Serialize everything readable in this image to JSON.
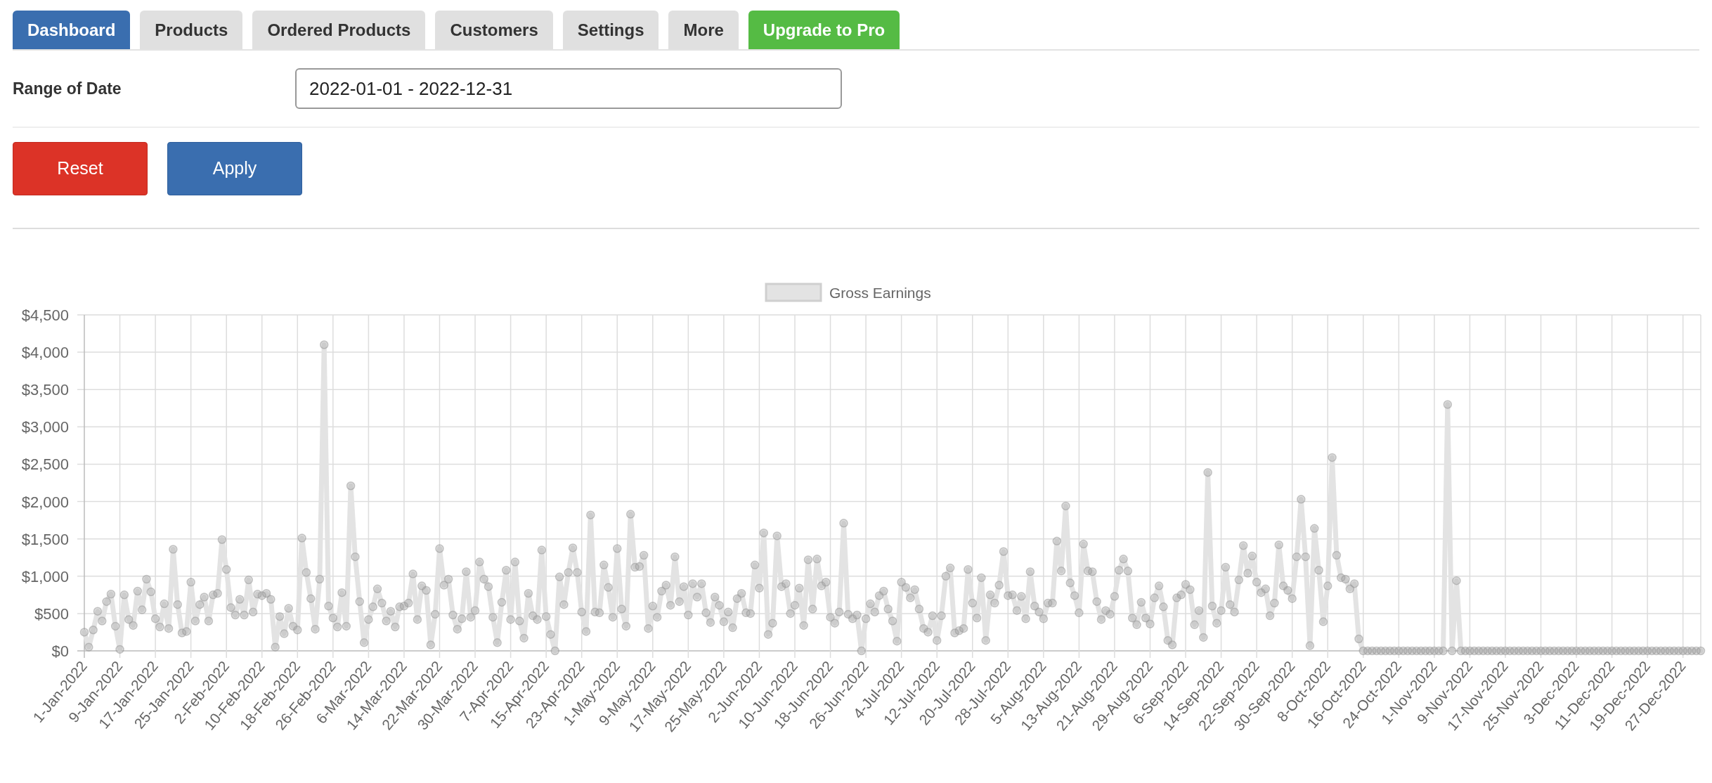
{
  "tabs": [
    {
      "label": "Dashboard",
      "selected": true,
      "kind": "normal"
    },
    {
      "label": "Products",
      "selected": false,
      "kind": "normal"
    },
    {
      "label": "Ordered Products",
      "selected": false,
      "kind": "normal"
    },
    {
      "label": "Customers",
      "selected": false,
      "kind": "normal"
    },
    {
      "label": "Settings",
      "selected": false,
      "kind": "normal"
    },
    {
      "label": "More",
      "selected": false,
      "kind": "normal"
    },
    {
      "label": "Upgrade to Pro",
      "selected": false,
      "kind": "upgrade"
    }
  ],
  "date_range": {
    "label": "Range of Date",
    "value": "2022-01-01 - 2022-12-31"
  },
  "buttons": [
    {
      "label": "Reset",
      "kind": "danger"
    },
    {
      "label": "Apply",
      "kind": "primary"
    }
  ],
  "chart": {
    "chart_data": {
      "type": "line",
      "grid": true,
      "ylim": [
        0,
        4500
      ],
      "categories": [
        "1-Jan-2022",
        null,
        null,
        null,
        null,
        null,
        null,
        null,
        "9-Jan-2022",
        null,
        null,
        null,
        null,
        null,
        null,
        null,
        "17-Jan-2022",
        null,
        null,
        null,
        null,
        null,
        null,
        null,
        "25-Jan-2022",
        null,
        null,
        null,
        null,
        null,
        null,
        null,
        "2-Feb-2022",
        null,
        null,
        null,
        null,
        null,
        null,
        null,
        "10-Feb-2022",
        null,
        null,
        null,
        null,
        null,
        null,
        null,
        "18-Feb-2022",
        null,
        null,
        null,
        null,
        null,
        null,
        null,
        "26-Feb-2022",
        null,
        null,
        null,
        null,
        null,
        null,
        null,
        "6-Mar-2022",
        null,
        null,
        null,
        null,
        null,
        null,
        null,
        "14-Mar-2022",
        null,
        null,
        null,
        null,
        null,
        null,
        null,
        "22-Mar-2022",
        null,
        null,
        null,
        null,
        null,
        null,
        null,
        "30-Mar-2022",
        null,
        null,
        null,
        null,
        null,
        null,
        null,
        "7-Apr-2022",
        null,
        null,
        null,
        null,
        null,
        null,
        null,
        "15-Apr-2022",
        null,
        null,
        null,
        null,
        null,
        null,
        null,
        "23-Apr-2022",
        null,
        null,
        null,
        null,
        null,
        null,
        null,
        "1-May-2022",
        null,
        null,
        null,
        null,
        null,
        null,
        null,
        "9-May-2022",
        null,
        null,
        null,
        null,
        null,
        null,
        null,
        "17-May-2022",
        null,
        null,
        null,
        null,
        null,
        null,
        null,
        "25-May-2022",
        null,
        null,
        null,
        null,
        null,
        null,
        null,
        "2-Jun-2022",
        null,
        null,
        null,
        null,
        null,
        null,
        null,
        "10-Jun-2022",
        null,
        null,
        null,
        null,
        null,
        null,
        null,
        "18-Jun-2022",
        null,
        null,
        null,
        null,
        null,
        null,
        null,
        "26-Jun-2022",
        null,
        null,
        null,
        null,
        null,
        null,
        null,
        "4-Jul-2022",
        null,
        null,
        null,
        null,
        null,
        null,
        null,
        "12-Jul-2022",
        null,
        null,
        null,
        null,
        null,
        null,
        null,
        "20-Jul-2022",
        null,
        null,
        null,
        null,
        null,
        null,
        null,
        "28-Jul-2022",
        null,
        null,
        null,
        null,
        null,
        null,
        null,
        "5-Aug-2022",
        null,
        null,
        null,
        null,
        null,
        null,
        null,
        "13-Aug-2022",
        null,
        null,
        null,
        null,
        null,
        null,
        null,
        "21-Aug-2022",
        null,
        null,
        null,
        null,
        null,
        null,
        null,
        "29-Aug-2022",
        null,
        null,
        null,
        null,
        null,
        null,
        null,
        "6-Sep-2022",
        null,
        null,
        null,
        null,
        null,
        null,
        null,
        "14-Sep-2022",
        null,
        null,
        null,
        null,
        null,
        null,
        null,
        "22-Sep-2022",
        null,
        null,
        null,
        null,
        null,
        null,
        null,
        "30-Sep-2022",
        null,
        null,
        null,
        null,
        null,
        null,
        null,
        "8-Oct-2022",
        null,
        null,
        null,
        null,
        null,
        null,
        null,
        "16-Oct-2022",
        null,
        null,
        null,
        null,
        null,
        null,
        null,
        "24-Oct-2022",
        null,
        null,
        null,
        null,
        null,
        null,
        null,
        "1-Nov-2022",
        null,
        null,
        null,
        null,
        null,
        null,
        null,
        "9-Nov-2022",
        null,
        null,
        null,
        null,
        null,
        null,
        null,
        "17-Nov-2022",
        null,
        null,
        null,
        null,
        null,
        null,
        null,
        "25-Nov-2022",
        null,
        null,
        null,
        null,
        null,
        null,
        null,
        "3-Dec-2022",
        null,
        null,
        null,
        null,
        null,
        null,
        null,
        "11-Dec-2022",
        null,
        null,
        null,
        null,
        null,
        null,
        null,
        "19-Dec-2022",
        null,
        null,
        null,
        null,
        null,
        null,
        null,
        "27-Dec-2022",
        null,
        null,
        null,
        null
      ],
      "yticks": [
        {
          "value": 0,
          "label": "$0"
        },
        {
          "value": 500,
          "label": "$500"
        },
        {
          "value": 1000,
          "label": "$1,000"
        },
        {
          "value": 1500,
          "label": "$1,500"
        },
        {
          "value": 2000,
          "label": "$2,000"
        },
        {
          "value": 2500,
          "label": "$2,500"
        },
        {
          "value": 3000,
          "label": "$3,000"
        },
        {
          "value": 3500,
          "label": "$3,500"
        },
        {
          "value": 4000,
          "label": "$4,000"
        },
        {
          "value": 4500,
          "label": "$4,500"
        }
      ],
      "series": [
        {
          "name": "Gross Earnings",
          "color": "#e3e3e3",
          "marker": "circle",
          "values": [
            250,
            50,
            280,
            530,
            400,
            660,
            760,
            330,
            20,
            750,
            420,
            340,
            800,
            550,
            960,
            790,
            430,
            320,
            630,
            300,
            1360,
            620,
            240,
            260,
            920,
            400,
            620,
            720,
            400,
            750,
            770,
            1490,
            1090,
            580,
            480,
            690,
            480,
            950,
            520,
            760,
            740,
            770,
            690,
            50,
            460,
            230,
            570,
            330,
            280,
            1510,
            1050,
            700,
            290,
            960,
            4100,
            600,
            440,
            320,
            780,
            330,
            2210,
            1260,
            660,
            110,
            420,
            590,
            830,
            640,
            400,
            530,
            320,
            590,
            600,
            640,
            1030,
            420,
            870,
            810,
            80,
            490,
            1370,
            880,
            960,
            480,
            290,
            430,
            1060,
            450,
            540,
            1190,
            960,
            860,
            450,
            110,
            650,
            1080,
            420,
            1190,
            400,
            170,
            770,
            470,
            420,
            1350,
            460,
            220,
            0,
            990,
            620,
            1050,
            1380,
            1050,
            520,
            260,
            1820,
            520,
            510,
            1150,
            850,
            450,
            1370,
            560,
            330,
            1830,
            1120,
            1130,
            1280,
            300,
            600,
            450,
            800,
            880,
            610,
            1260,
            660,
            860,
            480,
            900,
            720,
            900,
            510,
            380,
            720,
            610,
            390,
            520,
            310,
            700,
            770,
            510,
            500,
            1150,
            840,
            1580,
            220,
            370,
            1540,
            860,
            900,
            500,
            610,
            840,
            340,
            1220,
            560,
            1230,
            870,
            920,
            450,
            370,
            520,
            1710,
            490,
            430,
            480,
            0,
            430,
            630,
            520,
            740,
            800,
            560,
            400,
            130,
            920,
            850,
            710,
            820,
            560,
            300,
            250,
            470,
            140,
            470,
            1000,
            1110,
            240,
            270,
            300,
            1090,
            640,
            440,
            980,
            140,
            750,
            640,
            880,
            1330,
            740,
            750,
            540,
            730,
            430,
            1060,
            600,
            520,
            430,
            640,
            640,
            1470,
            1070,
            1940,
            910,
            740,
            510,
            1430,
            1070,
            1060,
            660,
            420,
            540,
            490,
            730,
            1080,
            1230,
            1070,
            440,
            350,
            650,
            440,
            360,
            710,
            870,
            590,
            140,
            80,
            710,
            750,
            890,
            820,
            350,
            540,
            180,
            2390,
            600,
            370,
            540,
            1120,
            620,
            520,
            950,
            1410,
            1040,
            1270,
            920,
            780,
            830,
            470,
            640,
            1420,
            870,
            810,
            700,
            1260,
            2030,
            1260,
            70,
            1640,
            1080,
            390,
            870,
            2590,
            1280,
            980,
            960,
            830,
            900,
            160,
            0,
            0,
            0,
            0,
            0,
            0,
            0,
            0,
            0,
            0,
            0,
            0,
            0,
            0,
            0,
            0,
            0,
            0,
            0,
            3300,
            0,
            940,
            0,
            0,
            0,
            0,
            0,
            0,
            0,
            0,
            0,
            0,
            0,
            0,
            0,
            0,
            0,
            0,
            0,
            0,
            0,
            0,
            0,
            0,
            0,
            0,
            0,
            0,
            0,
            0,
            0,
            0,
            0,
            0,
            0,
            0,
            0,
            0,
            0,
            0,
            0,
            0,
            0,
            0,
            0,
            0,
            0,
            0,
            0,
            0,
            0,
            0,
            0,
            0,
            0,
            0,
            0
          ]
        }
      ]
    }
  }
}
